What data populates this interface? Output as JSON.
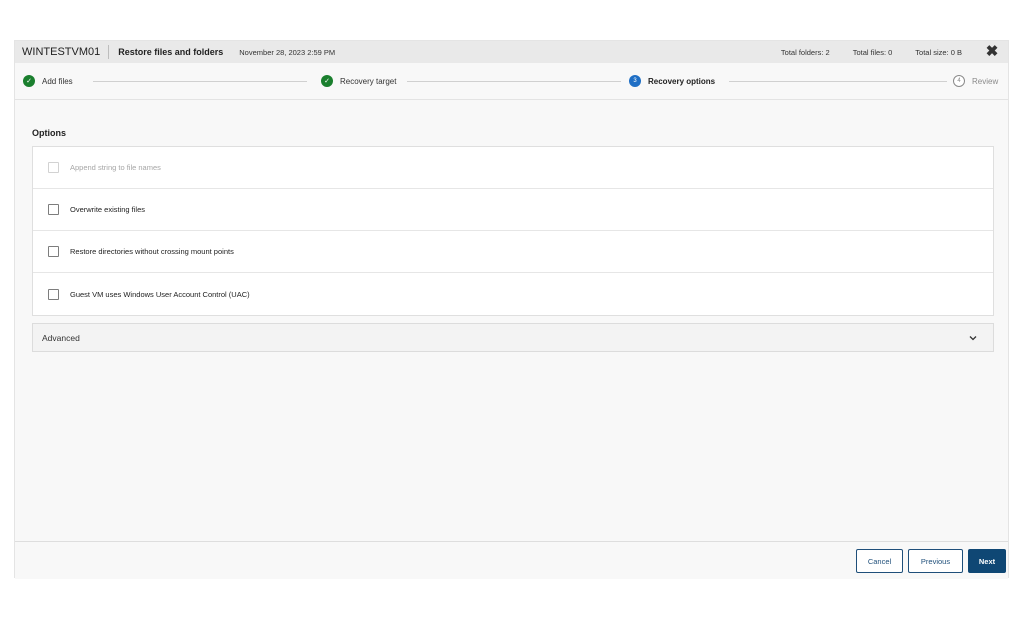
{
  "header": {
    "vm_name": "WINTESTVM01",
    "title": "Restore files and folders",
    "date": "November 28, 2023 2:59 PM",
    "total_folders": "Total folders: 2",
    "total_files": "Total files: 0",
    "total_size": "Total size: 0 B",
    "close_icon": "close-icon"
  },
  "steps": [
    {
      "label": "Add files",
      "state": "done"
    },
    {
      "label": "Recovery target",
      "state": "done"
    },
    {
      "label": "Recovery options",
      "state": "current",
      "number": "3"
    },
    {
      "label": "Review",
      "state": "pending",
      "number": "4"
    }
  ],
  "options": {
    "title": "Options",
    "items": [
      {
        "label": "Append string to file names",
        "checked": false,
        "disabled": true
      },
      {
        "label": "Overwrite existing files",
        "checked": false,
        "disabled": false
      },
      {
        "label": "Restore directories without crossing mount points",
        "checked": false,
        "disabled": false
      },
      {
        "label": "Guest VM uses Windows User Account Control (UAC)",
        "checked": false,
        "disabled": false
      }
    ]
  },
  "advanced": {
    "label": "Advanced",
    "expanded": false
  },
  "footer": {
    "cancel_label": "Cancel",
    "previous_label": "Previous",
    "next_label": "Next"
  },
  "colors": {
    "done": "#1a7f2e",
    "current": "#1f6fc5",
    "primary": "#0f4774"
  }
}
